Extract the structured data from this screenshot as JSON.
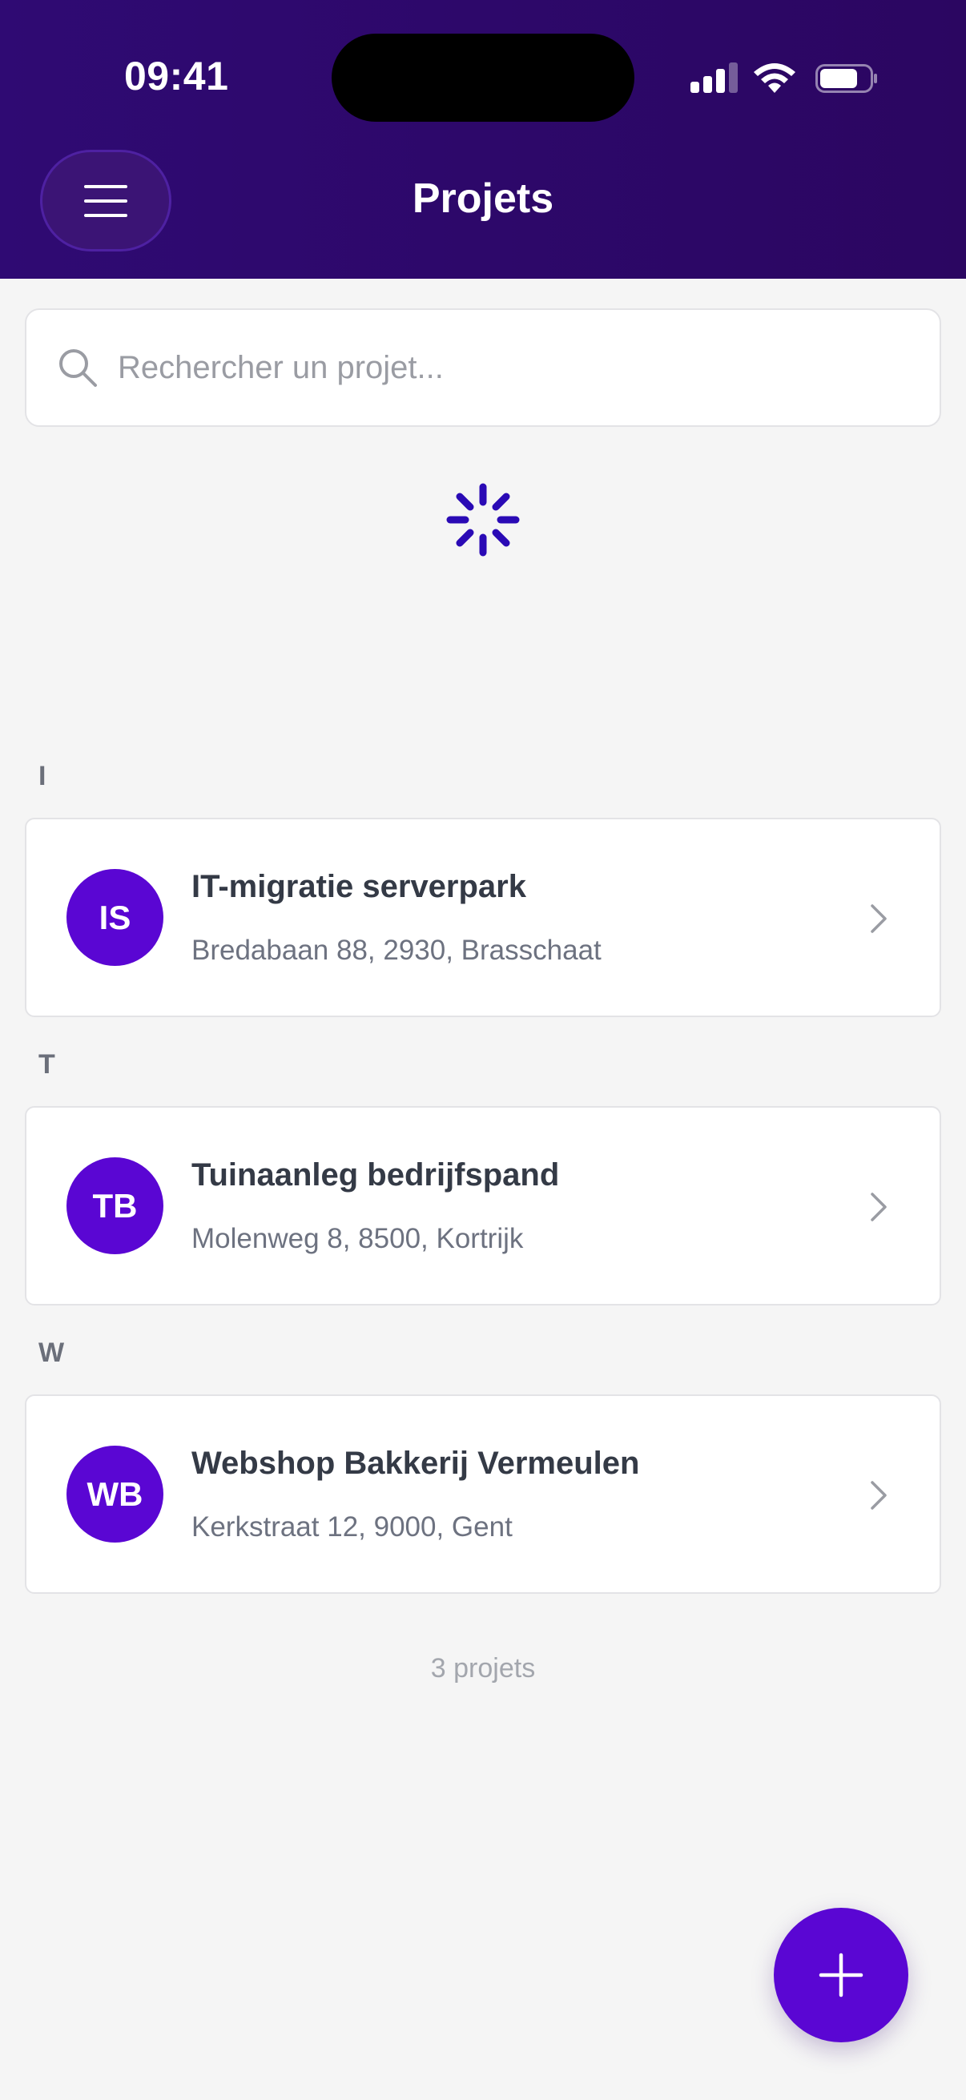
{
  "status_bar": {
    "time": "09:41"
  },
  "header": {
    "title": "Projets",
    "menu_icon": "hamburger-menu-icon"
  },
  "search": {
    "placeholder": "Rechercher un projet...",
    "value": ""
  },
  "sections": [
    {
      "letter": "I",
      "project": {
        "initials": "IS",
        "name": "IT-migratie serverpark",
        "address": "Bredabaan 88, 2930, Brasschaat"
      }
    },
    {
      "letter": "T",
      "project": {
        "initials": "TB",
        "name": "Tuinaanleg bedrijfspand",
        "address": "Molenweg 8, 8500, Kortrijk"
      }
    },
    {
      "letter": "W",
      "project": {
        "initials": "WB",
        "name": "Webshop Bakkerij Vermeulen",
        "address": "Kerkstraat 12, 9000, Gent"
      }
    }
  ],
  "footer": {
    "count_label": "3 projets"
  },
  "fab": {
    "icon": "plus-icon"
  },
  "colors": {
    "header_bg": "#2d0768",
    "accent": "#5a06d3",
    "spinner": "#2a0ab5",
    "background": "#f5f5f5"
  }
}
